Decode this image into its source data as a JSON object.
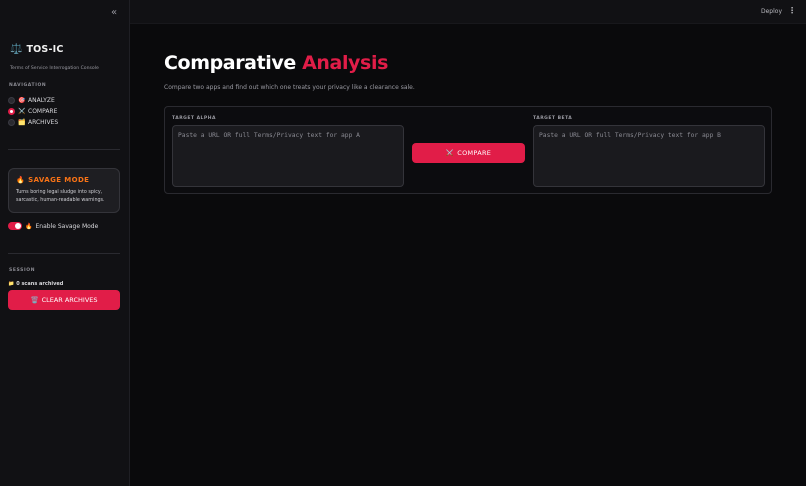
{
  "topbar": {
    "deploy_label": "Deploy",
    "menu_icon": "⋮"
  },
  "sidebar": {
    "collapse_icon": "«",
    "brand": {
      "icon": "⚖️",
      "title": "TOS-IC",
      "subtitle": "Terms of Service Interrogation Console"
    },
    "navigation_label": "NAVIGATION",
    "nav_items": [
      {
        "emoji": "🎯",
        "label": "ANALYZE",
        "selected": false
      },
      {
        "emoji": "⚔️",
        "label": "COMPARE",
        "selected": true
      },
      {
        "emoji": "🗂️",
        "label": "ARCHIVES",
        "selected": false
      }
    ],
    "savage": {
      "emoji": "🔥",
      "title": "SAVAGE MODE",
      "description": "Turns boring legal sludge into spicy, sarcastic, human-readable warnings."
    },
    "toggle": {
      "emoji": "🔥",
      "label": "Enable Savage Mode",
      "enabled": true
    },
    "session_label": "SESSION",
    "scans": {
      "emoji": "📁",
      "text": "0 scans archived"
    },
    "clear_button": {
      "emoji": "🗑️",
      "label": "CLEAR ARCHIVES"
    }
  },
  "main": {
    "title_plain": "Comparative",
    "title_accent": "Analysis",
    "description": "Compare two apps and find out which one treats your privacy like a clearance sale.",
    "target_alpha": {
      "label": "TARGET ALPHA",
      "placeholder": "Paste a URL OR full Terms/Privacy text for app A",
      "value": ""
    },
    "target_beta": {
      "label": "TARGET BETA",
      "placeholder": "Paste a URL OR full Terms/Privacy text for app B",
      "value": ""
    },
    "compare_button": {
      "emoji": "⚔️",
      "label": "COMPARE"
    }
  },
  "colors": {
    "accent": "#e11d48",
    "savage_orange": "#f97316",
    "background": "#0a0a0c",
    "sidebar": "#111114"
  }
}
